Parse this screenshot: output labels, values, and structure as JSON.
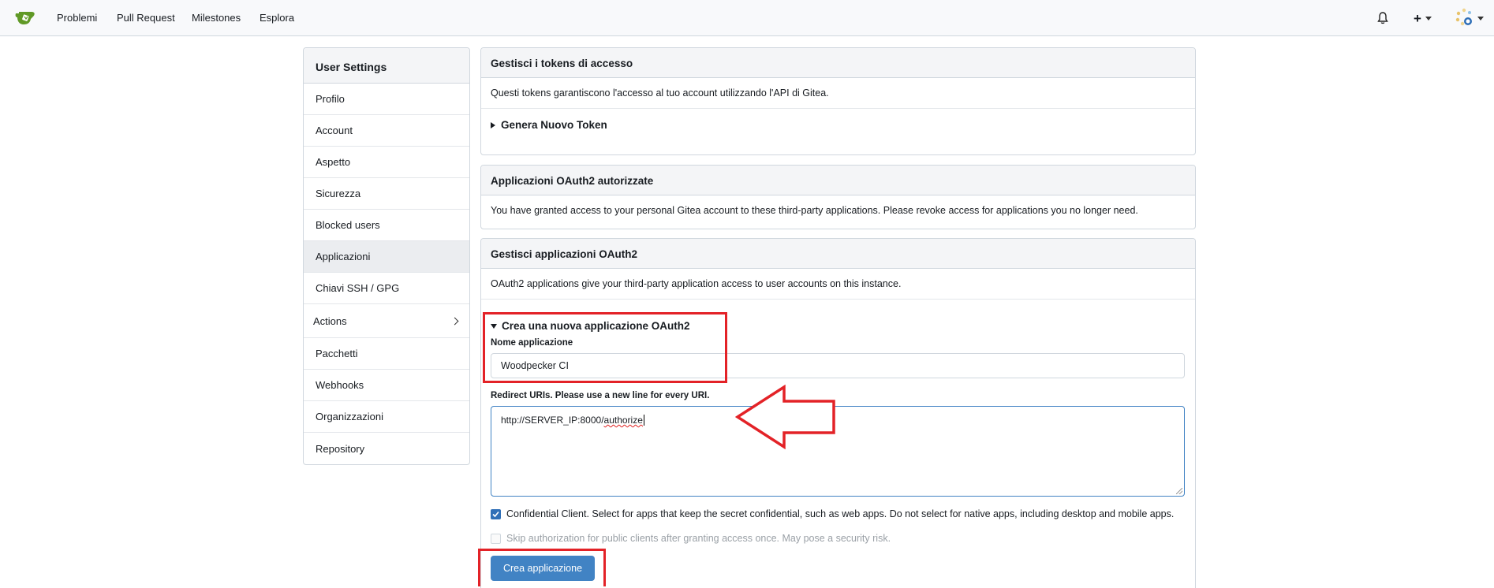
{
  "nav": {
    "logo_icon": "gitea-logo-icon",
    "items": [
      "Problemi",
      "Pull Request",
      "Milestones",
      "Esplora"
    ],
    "right_icons": [
      "bell-icon",
      "plus-icon",
      "avatar"
    ]
  },
  "sidebar": {
    "title": "User Settings",
    "items": [
      {
        "label": "Profilo"
      },
      {
        "label": "Account"
      },
      {
        "label": "Aspetto"
      },
      {
        "label": "Sicurezza"
      },
      {
        "label": "Blocked users"
      },
      {
        "label": "Applicazioni",
        "active": true
      },
      {
        "label": "Chiavi SSH / GPG"
      },
      {
        "label": "Actions",
        "has_submenu": true
      },
      {
        "label": "Pacchetti"
      },
      {
        "label": "Webhooks"
      },
      {
        "label": "Organizzazioni"
      },
      {
        "label": "Repository"
      }
    ]
  },
  "tokens": {
    "title": "Gestisci i tokens di accesso",
    "description": "Questi tokens garantiscono l'accesso al tuo account utilizzando l'API di Gitea.",
    "generate_label": "Genera Nuovo Token"
  },
  "authorized": {
    "title": "Applicazioni OAuth2 autorizzate",
    "description": "You have granted access to your personal Gitea account to these third-party applications. Please revoke access for applications you no longer need."
  },
  "manage": {
    "title": "Gestisci applicazioni OAuth2",
    "description": "OAuth2 applications give your third-party application access to user accounts on this instance.",
    "create_summary": "Crea una nuova applicazione OAuth2",
    "name_label": "Nome applicazione",
    "name_value": "Woodpecker CI",
    "redirect_label": "Redirect URIs. Please use a new line for every URI.",
    "redirect_value_prefix": "http://SERVER_IP:8000/",
    "redirect_value_suffix": "authorize",
    "confidential_label": "Confidential Client. Select for apps that keep the secret confidential, such as web apps. Do not select for native apps, including desktop and mobile apps.",
    "confidential_checked": true,
    "skip_label": "Skip authorization for public clients after granting access once. May pose a security risk.",
    "skip_checked": false,
    "create_button": "Crea applicazione"
  },
  "annotation_color": "#e32227",
  "accent_color": "#4183c4"
}
